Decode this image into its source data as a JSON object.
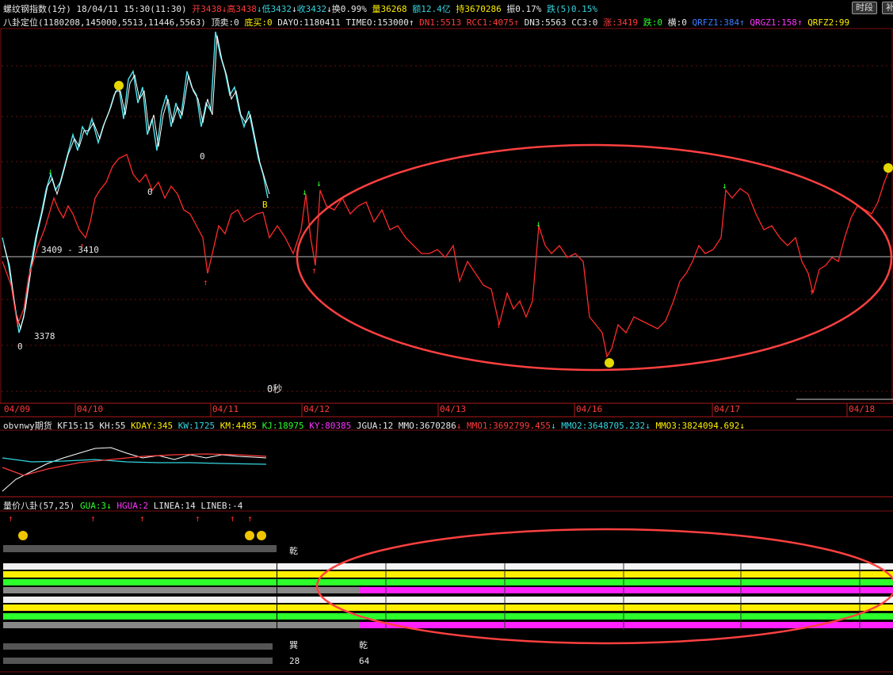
{
  "header": {
    "title": "螺纹钢指数(1分)",
    "datetime": "18/04/11 15:30(11:30)",
    "open": "开3438",
    "high": "高3438",
    "low": "低3432",
    "close": "收3432",
    "turnover": "换0.99%",
    "volume": "量36268",
    "amount": "额12.4亿",
    "position": "持3670286",
    "amplitude": "振0.17%",
    "change": "跌(5)0.15%",
    "btn_time": "时段",
    "btn_more": "补"
  },
  "indicator_line": {
    "name": "八卦定位(1180208,145000,5513,11446,5563)",
    "items": [
      {
        "t": "顶卖:0",
        "c": "wht"
      },
      {
        "t": "底买:0",
        "c": "yel"
      },
      {
        "t": "DAYO:1180411",
        "c": "wht"
      },
      {
        "t": "TIMEO:153000",
        "c": "wht"
      },
      {
        "t": "DN1:5513",
        "c": "red"
      },
      {
        "t": "RCC1:4075",
        "c": "red"
      },
      {
        "t": "DN3:5563",
        "c": "wht"
      },
      {
        "t": "CC3:0",
        "c": "wht"
      },
      {
        "t": "涨:3419",
        "c": "red"
      },
      {
        "t": "跌:0",
        "c": "grn"
      },
      {
        "t": "横:0",
        "c": "wht"
      },
      {
        "t": "QRFZ1:384",
        "c": "blu"
      },
      {
        "t": "QRGZ1:158",
        "c": "mag"
      },
      {
        "t": "QRFZ2:99",
        "c": "yel"
      }
    ]
  },
  "main_chart": {
    "level_label": "3409 - 3410",
    "low_label": "3378",
    "zero_labels": [
      "0",
      "0",
      "0",
      "0"
    ],
    "b_label": "B",
    "timer": "0秒",
    "dates": [
      "04/09",
      "04/10",
      "04/11",
      "04/12",
      "04/13",
      "04/16",
      "04/17",
      "04/18"
    ]
  },
  "sub1": {
    "name": "obvnwy期货",
    "items": [
      {
        "t": "KF15:15",
        "c": "wht"
      },
      {
        "t": "KH:55",
        "c": "wht"
      },
      {
        "t": "KDAY:345",
        "c": "yel"
      },
      {
        "t": "KW:1725",
        "c": "cyn"
      },
      {
        "t": "KM:4485",
        "c": "yel"
      },
      {
        "t": "KJ:18975",
        "c": "grn"
      },
      {
        "t": "KY:80385",
        "c": "mag"
      },
      {
        "t": "JGUA:12",
        "c": "wht"
      },
      {
        "t": "MMO:3670286",
        "c": "wht"
      },
      {
        "t": "MMO1:3692799.455",
        "c": "red"
      },
      {
        "t": "MMO2:3648705.232",
        "c": "cyn"
      },
      {
        "t": "MMO3:3824094.692",
        "c": "yel"
      }
    ]
  },
  "sub2": {
    "name": "量价八卦(57,25)",
    "items": [
      {
        "t": "GUA:3",
        "c": "grn"
      },
      {
        "t": "HGUA:2",
        "c": "mag"
      },
      {
        "t": "LINEA:14",
        "c": "wht"
      },
      {
        "t": "LINEB:-4",
        "c": "wht"
      }
    ],
    "gua_label_1": "乾",
    "gua_label_2": "巽",
    "gua_label_3": "乾",
    "num_1": "28",
    "num_2": "64"
  }
}
